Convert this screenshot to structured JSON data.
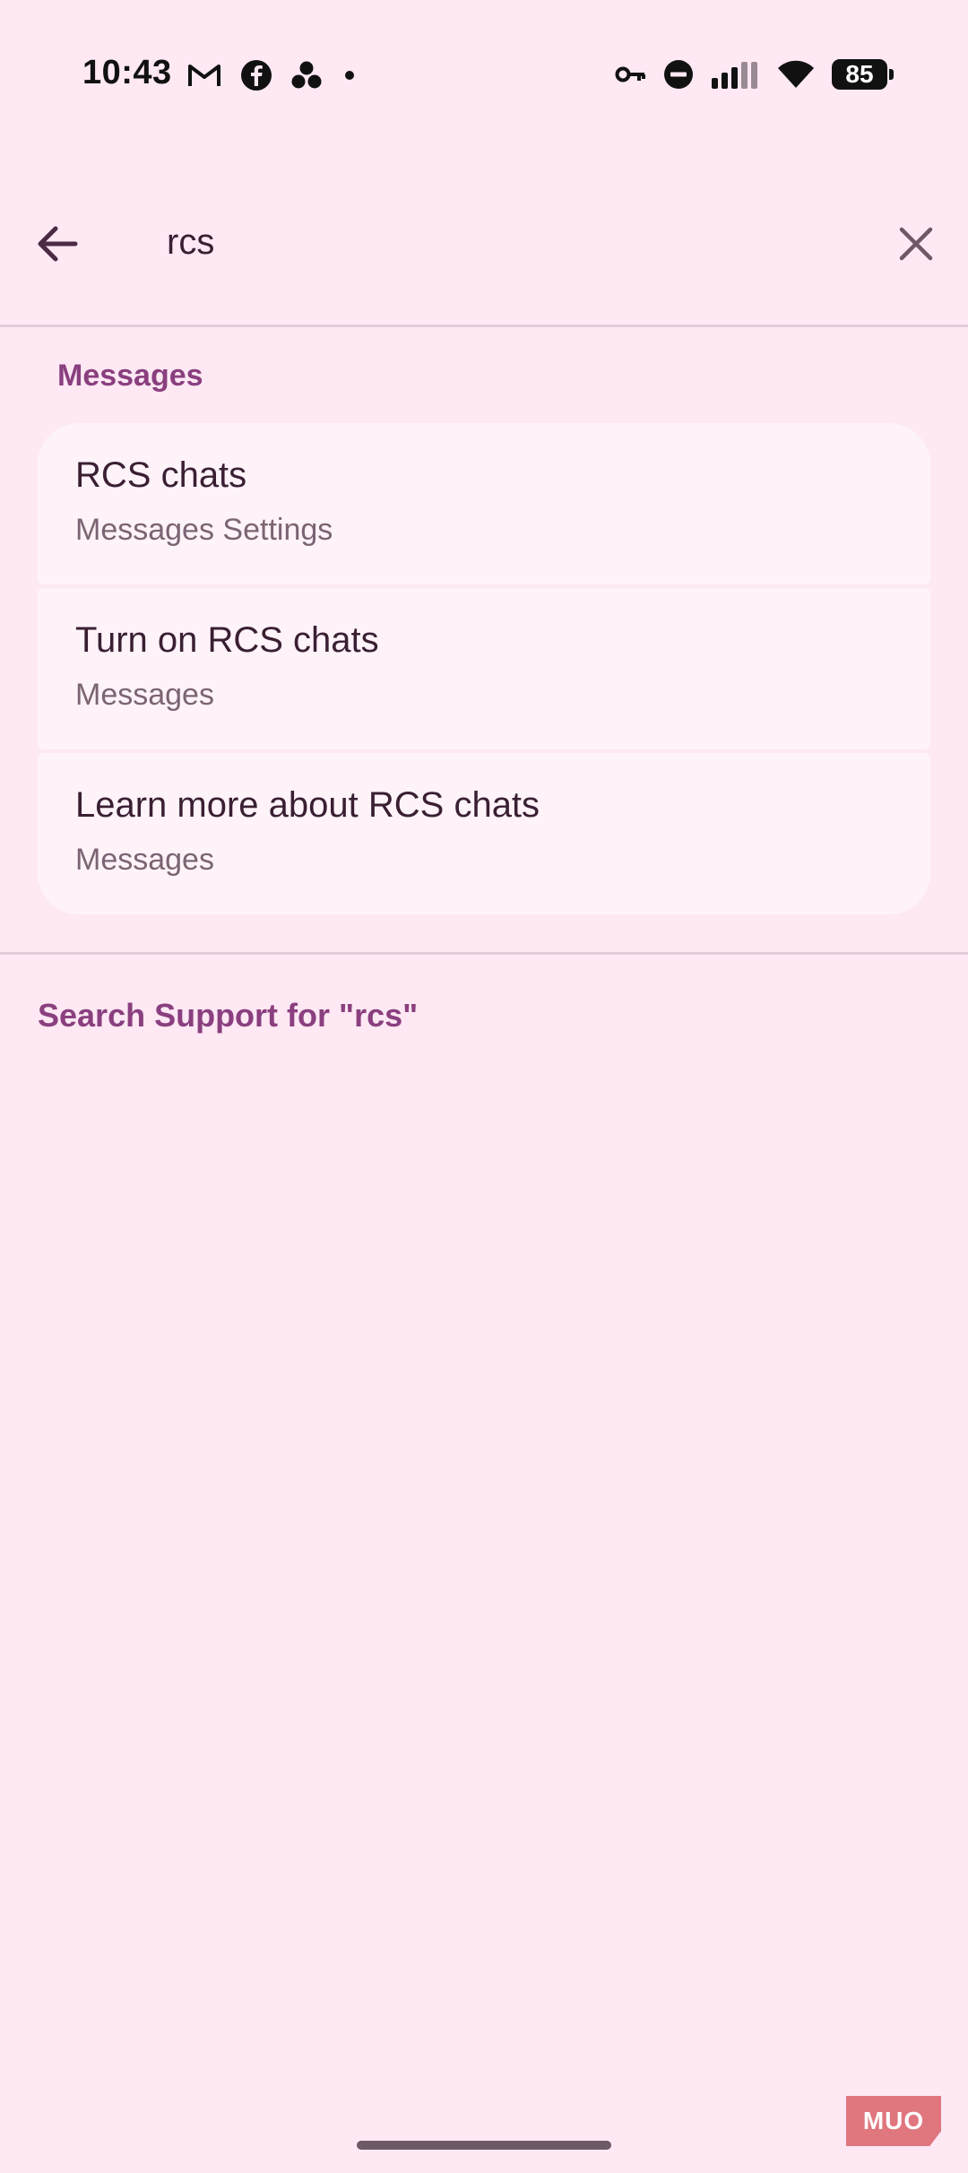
{
  "status_bar": {
    "time": "10:43",
    "battery": "85",
    "left_icons": [
      "gmail-icon",
      "facebook-icon",
      "app-dots-icon",
      "dot-icon"
    ],
    "right_icons": [
      "vpn-key-icon",
      "dnd-icon",
      "signal-icon",
      "wifi-icon",
      "battery-icon"
    ]
  },
  "search": {
    "query": "rcs",
    "back_icon": "arrow-left-icon",
    "clear_icon": "close-icon"
  },
  "results": {
    "section_title": "Messages",
    "items": [
      {
        "title": "RCS chats",
        "subtitle": "Messages Settings"
      },
      {
        "title": "Turn on RCS chats",
        "subtitle": "Messages"
      },
      {
        "title": "Learn more about RCS chats",
        "subtitle": "Messages"
      }
    ]
  },
  "support": {
    "label": "Search Support for \"rcs\""
  },
  "watermark": {
    "text": "MUO"
  },
  "colors": {
    "background": "#fde8f4",
    "card": "#fef3f9",
    "accent": "#8a3f7f",
    "text_primary": "#3a1f33",
    "text_secondary": "#7b6473"
  }
}
